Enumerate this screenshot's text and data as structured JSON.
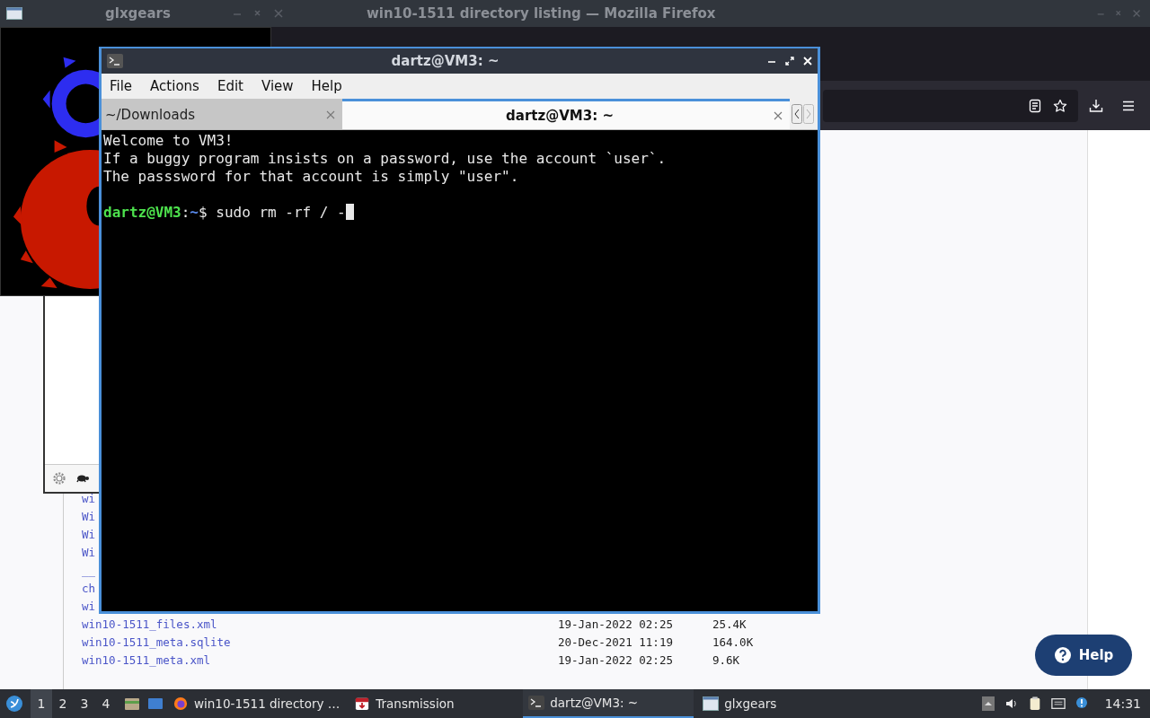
{
  "top_bar": {
    "windows": [
      {
        "title": "glxgears"
      },
      {
        "title": "win10-1511 directory listing — Mozilla Firefox"
      }
    ]
  },
  "listing": [
    {
      "name": "wi"
    },
    {
      "name": "Wi"
    },
    {
      "name": "Wi"
    },
    {
      "name": "Wi"
    },
    {
      "name": "__"
    },
    {
      "name": "ch"
    },
    {
      "name": "wi"
    },
    {
      "name": "win10-1511_files.xml",
      "date": "19-Jan-2022 02:25",
      "size": "25.4K"
    },
    {
      "name": "win10-1511_meta.sqlite",
      "date": "20-Dec-2021 11:19",
      "size": "164.0K"
    },
    {
      "name": "win10-1511_meta.xml",
      "date": "19-Jan-2022 02:25",
      "size": "9.6K"
    }
  ],
  "help_button": "Help",
  "terminal": {
    "title": "dartz@VM3: ~",
    "menu": [
      "File",
      "Actions",
      "Edit",
      "View",
      "Help"
    ],
    "tabs": [
      {
        "label": "~/Downloads",
        "selected": false
      },
      {
        "label": "dartz@VM3: ~",
        "selected": true
      }
    ],
    "lines": [
      "Welcome to VM3!",
      "If a buggy program insists on a password, use the account `user`.",
      "The passsword for that account is simply \"user\"."
    ],
    "prompt": {
      "user": "dartz@VM3",
      "separator": ":",
      "path": "~",
      "command": "$ sudo rm -rf / -"
    }
  },
  "taskbar": {
    "workspaces": [
      {
        "label": "1",
        "selected": true
      },
      {
        "label": "2",
        "selected": false
      },
      {
        "label": "3",
        "selected": false
      },
      {
        "label": "4",
        "selected": false
      }
    ],
    "tasks": [
      {
        "kind": "firefox",
        "label": "win10-1511 directory …",
        "selected": false
      },
      {
        "kind": "transmission",
        "label": "Transmission",
        "selected": false
      },
      {
        "kind": "terminal",
        "label": "dartz@VM3: ~",
        "selected": true
      },
      {
        "kind": "window",
        "label": "glxgears",
        "selected": false
      }
    ],
    "clock": "14:31"
  }
}
